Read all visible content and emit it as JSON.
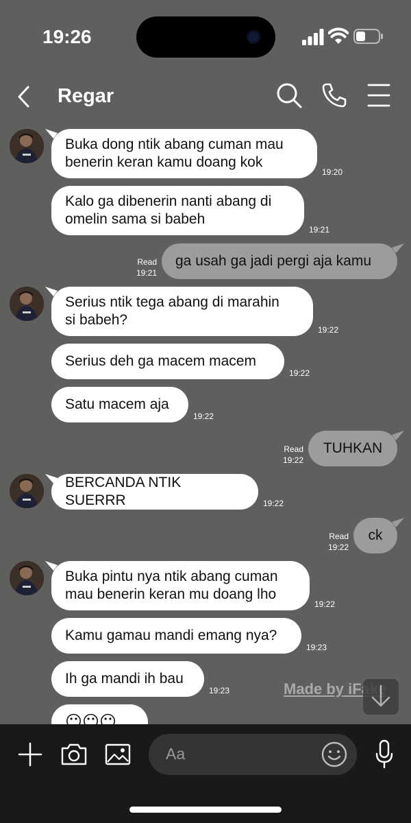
{
  "status": {
    "time": "19:26"
  },
  "header": {
    "contact_name": "Regar"
  },
  "messages": [
    {
      "text": "Buka dong ntik abang cuman mau\nbenerin keran kamu doang kok",
      "time": "19:20"
    },
    {
      "text": "Kalo ga dibenerin nanti abang di\nomelin sama si babeh",
      "time": "19:21"
    },
    {
      "text": "ga usah ga jadi pergi aja kamu",
      "read": "Read",
      "time": "19:21"
    },
    {
      "text": "Serius ntik tega abang di marahin\nsi babeh?",
      "time": "19:22"
    },
    {
      "text": "Serius deh ga macem macem",
      "time": "19:22"
    },
    {
      "text": "Satu macem aja",
      "time": "19:22"
    },
    {
      "text": "TUHKAN",
      "read": "Read",
      "time": "19:22"
    },
    {
      "text": "BERCANDA NTIK SUERRR",
      "time": "19:22"
    },
    {
      "text": "ck",
      "read": "Read",
      "time": "19:22"
    },
    {
      "text": "Buka pintu nya ntik abang cuman\nmau benerin keran mu doang lho",
      "time": "19:22"
    },
    {
      "text": "Kamu gamau mandi emang nya?",
      "time": "19:23"
    },
    {
      "text": "Ih ga mandi ih bau",
      "time": "19:23"
    },
    {
      "text": "😶😶😶"
    }
  ],
  "watermark": "Made by iFake",
  "composer": {
    "placeholder": "Aa"
  },
  "colors": {
    "background": "#5f605e",
    "incoming_bubble": "#ffffff",
    "outgoing_bubble": "#9d9b9c",
    "bottom_bar": "#191919"
  }
}
